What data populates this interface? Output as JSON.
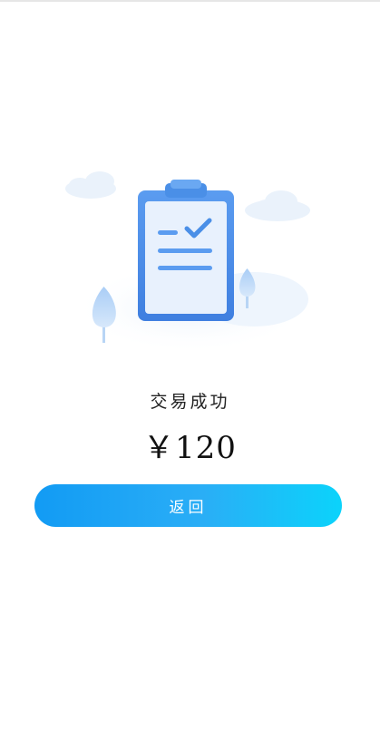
{
  "result": {
    "status_text": "交易成功",
    "amount": "￥120",
    "return_label": "返回"
  },
  "illustration": {
    "icon": "clipboard-check-icon",
    "accent_color": "#4a8fe7",
    "paper_color": "#e8f1fd"
  },
  "button": {
    "gradient_start": "#129bf4",
    "gradient_end": "#0bd3fb"
  }
}
